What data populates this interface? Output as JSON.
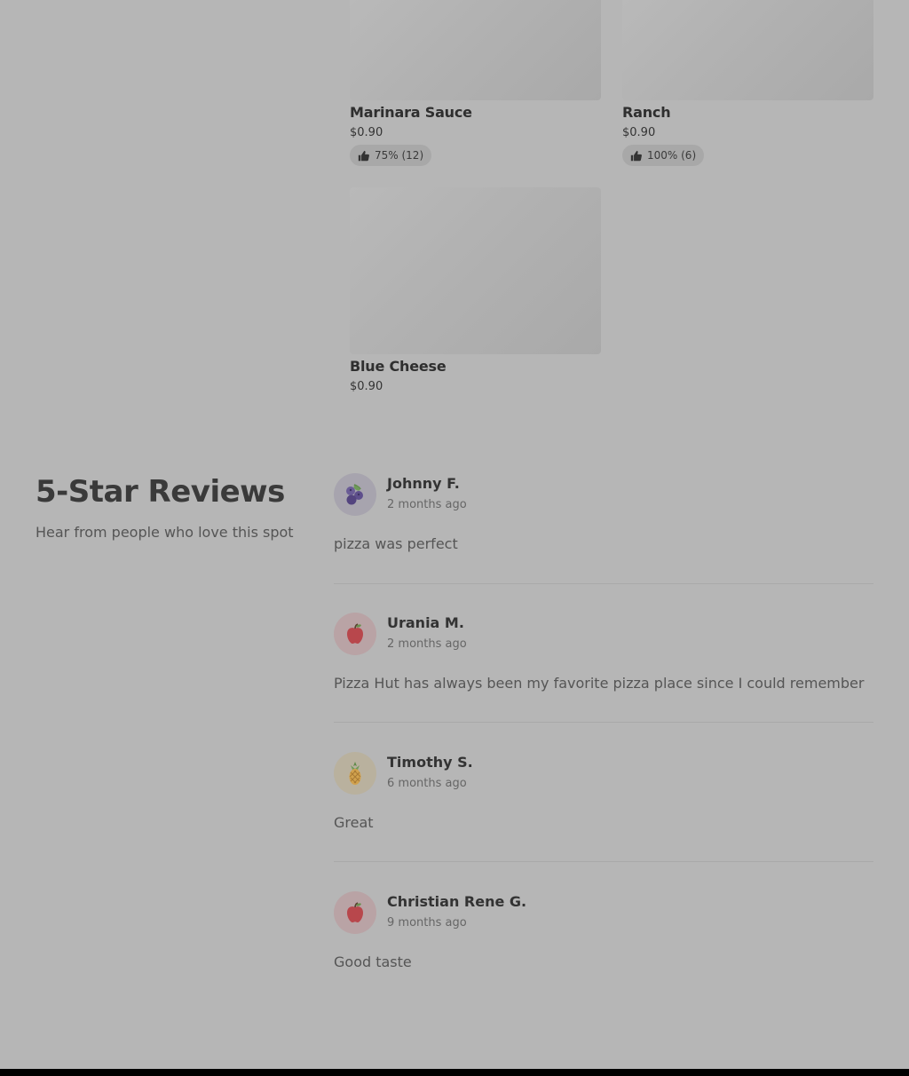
{
  "products": [
    {
      "name": "Marinara Sauce",
      "price": "$0.90",
      "rating": "75% (12)"
    },
    {
      "name": "Ranch",
      "price": "$0.90",
      "rating": "100% (6)"
    },
    {
      "name": "Blue Cheese",
      "price": "$0.90"
    }
  ],
  "reviews_section": {
    "title": "5-Star Reviews",
    "subtitle": "Hear from people who love this spot",
    "items": [
      {
        "name": "Johnny F.",
        "time": "2 months ago",
        "text": "pizza was perfect",
        "avatar_icon": "blueberry-icon"
      },
      {
        "name": "Urania M.",
        "time": "2 months ago",
        "text": "Pizza Hut has always been my favorite pizza place since I could remember",
        "avatar_icon": "apple-icon"
      },
      {
        "name": "Timothy S.",
        "time": "6 months ago",
        "text": "Great",
        "avatar_icon": "pineapple-icon"
      },
      {
        "name": "Christian Rene G.",
        "time": "9 months ago",
        "text": "Good taste",
        "avatar_icon": "apple-icon"
      }
    ]
  },
  "colors": {
    "overlay_background": "#b6b6b6",
    "avatar_blueberry_bg": "#a7a4ae",
    "avatar_apple_bg": "#b9a3a5",
    "avatar_pineapple_bg": "#b9b19e"
  }
}
